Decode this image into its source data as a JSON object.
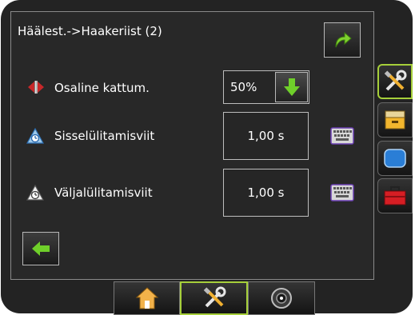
{
  "header": {
    "title": "Häälest.->Haakeriist (2)"
  },
  "rows": [
    {
      "label": "Osaline kattum.",
      "icon": "overlap-arrows-icon",
      "value": "50%"
    },
    {
      "label": "Sisselülitamisviit",
      "icon": "turn-on-delay-icon",
      "value": "1,00 s"
    },
    {
      "label": "Väljalülitamisviit",
      "icon": "turn-off-delay-icon",
      "value": "1,00 s"
    }
  ],
  "side_tabs": [
    {
      "icon": "tools-icon",
      "active": true
    },
    {
      "icon": "file-drawer-icon",
      "active": false
    },
    {
      "icon": "display-icon",
      "active": false
    },
    {
      "icon": "toolbox-icon",
      "active": false
    }
  ],
  "bottom_tabs": [
    {
      "icon": "home-icon",
      "active": false
    },
    {
      "icon": "tools-icon",
      "active": true
    },
    {
      "icon": "gauge-icon",
      "active": false
    }
  ],
  "colors": {
    "accent": "#a6cf3a",
    "panel": "#282828",
    "device": "#232323"
  }
}
